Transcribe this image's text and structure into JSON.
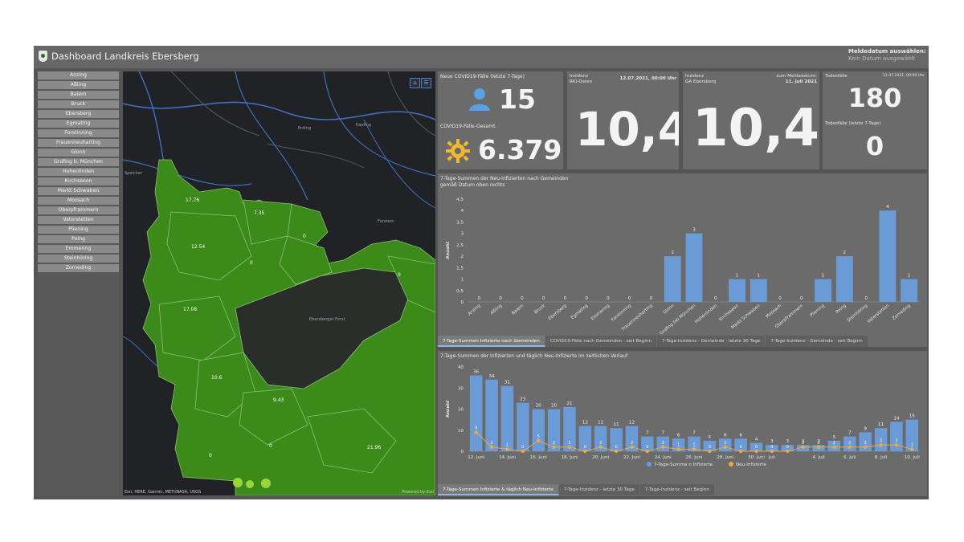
{
  "header": {
    "title": "Dashboard Landkreis Ebersberg",
    "date_label": "Meldedatum auswählen:",
    "date_value": "Kein Datum ausgewählt"
  },
  "sidebar": {
    "items": [
      "Anzing",
      "Aßling",
      "Baiern",
      "Bruck",
      "Ebersberg",
      "Egmating",
      "Forstinning",
      "Frauenneuharting",
      "Glonn",
      "Grafing b. München",
      "Hohenlinden",
      "Kirchseeon",
      "Markt Schwaben",
      "Moosach",
      "Oberpframmern",
      "Vaterstetten",
      "Pliening",
      "Poing",
      "Emmering",
      "Steinhöring",
      "Zorneding"
    ]
  },
  "map": {
    "attribution": "Esri, HERE, Garmin, METI/NASA, USGS",
    "powered": "Powered by Esri",
    "region_values": [
      "17.76",
      "7.35",
      "12.54",
      "0",
      "0",
      "0",
      "17.08",
      "10.6",
      "9.43",
      "0",
      "0",
      "21.96"
    ],
    "place_labels": [
      "Erding",
      "Speicher",
      "Kapfing",
      "Forstern",
      "Ebersberger Forst"
    ],
    "colors": {
      "land": "#3c8a1a",
      "forest": "#2a2e2a",
      "water": "#3f6fbf",
      "background": "#202226"
    }
  },
  "cases_panel": {
    "new_label": "Neue COVID19-Fälle (letzte 7-Tage)",
    "new_value": "15",
    "total_label": "COVID19-Fälle-Gesamt",
    "total_value": "6.379",
    "person_icon_color": "#5aa0e6",
    "virus_icon_color": "#f2b830"
  },
  "incidence_rki": {
    "label1": "Inzidenz",
    "label2": "RKI-Daten",
    "date": "12.07.2021, 00:00 Uhr",
    "value": "10,4"
  },
  "incidence_ga": {
    "label1": "Inzidenz",
    "label2": "GA Ebersberg",
    "date_label": "zum Meldedatum:",
    "date_value": "11. Juli 2021",
    "value": "10,4"
  },
  "deaths_panel": {
    "label": "Todesfälle",
    "date": "12.07.2021, 00:00 Uhr",
    "value": "180",
    "week_label": "Todesfälle (letzte 7-Tage)",
    "week_value": "0"
  },
  "chart1": {
    "title1": "7-Tage-Summen der Neu-Infizierten nach Gemeinden",
    "title2": "gemäß Datum oben rechts",
    "tabs": [
      "7-Tage-Summen Infizierte nach Gemeinden",
      "COVID19-Fälle nach Gemeinden - seit Beginn",
      "7-Tage-Inzidenz - Gemeinde - letzte 30 Tage",
      "7-Tage-Inzidenz - Gemeinde - seit Beginn"
    ]
  },
  "chart2": {
    "title": "7-Tage-Summen der Infizierten und täglich Neu-Infizierte im zeitlichen Verlauf",
    "legend_sum": "7-Tage-Summe n Infizierte",
    "legend_new": "Neu-Infizierte",
    "tabs": [
      "7-Tage-Summen Infizierte & täglich Neu-Infizierte",
      "7-Tage-Inzidenz - letzte 30 Tage",
      "7-Tage-Inzidenz - seit Beginn"
    ]
  },
  "chart_data": [
    {
      "type": "bar",
      "title": "7-Tage-Summen der Neu-Infizierten nach Gemeinden",
      "xlabel": "",
      "ylabel": "Anzahl",
      "ylim": [
        0,
        4.5
      ],
      "yticks": [
        "0",
        "0,5",
        "1",
        "1,5",
        "2",
        "2,5",
        "3",
        "3,5",
        "4",
        "4,5"
      ],
      "categories": [
        "Anzing",
        "Aßling",
        "Baiern",
        "Bruck",
        "Ebersberg",
        "Egmating",
        "Emmering",
        "Forstinning",
        "Frauenneuharting",
        "Glonn",
        "Grafing bei München",
        "Hohenlinden",
        "Kirchseeon",
        "Markt Schwaben",
        "Moosach",
        "Oberpframmern",
        "Pliening",
        "Poing",
        "Steinhöring",
        "Vaterstetten",
        "Zorneding"
      ],
      "values": [
        0,
        0,
        0,
        0,
        0,
        0,
        0,
        0,
        0,
        2,
        3,
        0,
        1,
        1,
        0,
        0,
        1,
        2,
        0,
        4,
        1
      ],
      "bar_color": "#6b9bd6",
      "grid": false
    },
    {
      "type": "bar",
      "title": "7-Tage-Summen der Infizierten und täglich Neu-Infizierte im zeitlichen Verlauf",
      "xlabel": "",
      "ylabel": "Anzahl",
      "ylim": [
        0,
        40
      ],
      "yticks": [
        "0",
        "10",
        "20",
        "30",
        "40"
      ],
      "x": [
        "12. Juni",
        "13. Juni",
        "14. Juni",
        "15. Juni",
        "16. Juni",
        "17. Juni",
        "18. Juni",
        "19. Juni",
        "20. Juni",
        "21. Juni",
        "22. Juni",
        "23. Juni",
        "24. Juni",
        "25. Juni",
        "26. Juni",
        "27. Juni",
        "28. Juni",
        "29. Juni",
        "30. Juni",
        "Juli",
        "2. Juli",
        "3. Juli",
        "4. Juli",
        "5. Juli",
        "6. Juli",
        "7. Juli",
        "8. Juli",
        "9. Juli",
        "10. Juli",
        "11. Juli"
      ],
      "x_tick_labels": [
        "12. Juni",
        "14. Juni",
        "16. Juni",
        "18. Juni",
        "20. Juni",
        "22. Juni",
        "24. Juni",
        "26. Juni",
        "28. Juni",
        "30. Juni",
        "Juli",
        "4. Juli",
        "6. Juli",
        "8. Juli",
        "10. Juli"
      ],
      "series": [
        {
          "name": "7-Tage-Summe n Infizierte",
          "kind": "bar",
          "color": "#6b9bd6",
          "values": [
            36,
            34,
            31,
            23,
            20,
            20,
            21,
            12,
            12,
            11,
            12,
            7,
            7,
            6,
            7,
            5,
            6,
            6,
            4,
            3,
            3,
            3,
            3,
            5,
            7,
            9,
            11,
            14,
            15
          ]
        },
        {
          "name": "Neu-Infizierte",
          "kind": "line",
          "color": "#f2a93b",
          "values": [
            9,
            2,
            1,
            0,
            5,
            2,
            2,
            0,
            2,
            0,
            2,
            0,
            2,
            1,
            1,
            0,
            2,
            0,
            0,
            0,
            0,
            2,
            2,
            2,
            2,
            2,
            3,
            3,
            1
          ]
        }
      ],
      "legend": "bottom-center",
      "grid": false
    }
  ]
}
